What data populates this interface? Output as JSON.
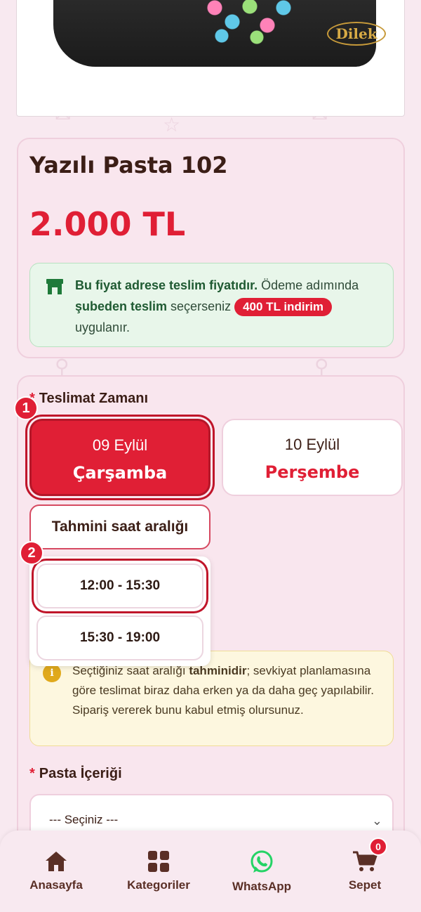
{
  "product": {
    "title": "Yazılı Pasta 102",
    "price": "2.000 TL",
    "image_logo": "Dilek"
  },
  "notice": {
    "icon": "shop-icon",
    "part1_bold": "Bu fiyat adrese teslim fiyatıdır.",
    "part2": " Ödeme adımında ",
    "part3_bold": "şubeden teslim",
    "part4": " seçerseniz ",
    "discount": "400 TL indirim",
    "part5": "uygulanır."
  },
  "delivery": {
    "label": "Teslimat Zamanı",
    "required_mark": "*",
    "days": [
      {
        "date": "09 Eylül",
        "weekday": "Çarşamba",
        "selected": true
      },
      {
        "date": "10 Eylül",
        "weekday": "Perşembe",
        "selected": false
      }
    ],
    "time_toggle_label": "Tahmini saat aralığı",
    "time_options": [
      "12:00 - 15:30",
      "15:30 - 19:00"
    ],
    "badges": [
      "1",
      "2"
    ]
  },
  "warning": {
    "icon": "info-icon",
    "icon_char": "i",
    "part1": "Seçtiğiniz saat aralığı ",
    "part2_bold": "tahminidir",
    "part3": "; sevkiyat planlamasına göre teslimat biraz daha erken ya da daha geç yapılabilir. Sipariş vererek bunu kabul etmiş olursunuz."
  },
  "cake_content": {
    "label": "Pasta İçeriği",
    "required_mark": "*",
    "selected": "--- Seçiniz ---"
  },
  "bottom_nav": {
    "items": [
      {
        "label": "Anasayfa",
        "icon": "home-icon"
      },
      {
        "label": "Kategoriler",
        "icon": "grid-icon"
      },
      {
        "label": "WhatsApp",
        "icon": "whatsapp-icon"
      },
      {
        "label": "Sepet",
        "icon": "cart-icon"
      }
    ],
    "cart_count": "0"
  },
  "colors": {
    "accent": "#e01f35",
    "background": "#f8e9f0",
    "text": "#3b1e16",
    "whatsapp": "#25d366"
  }
}
